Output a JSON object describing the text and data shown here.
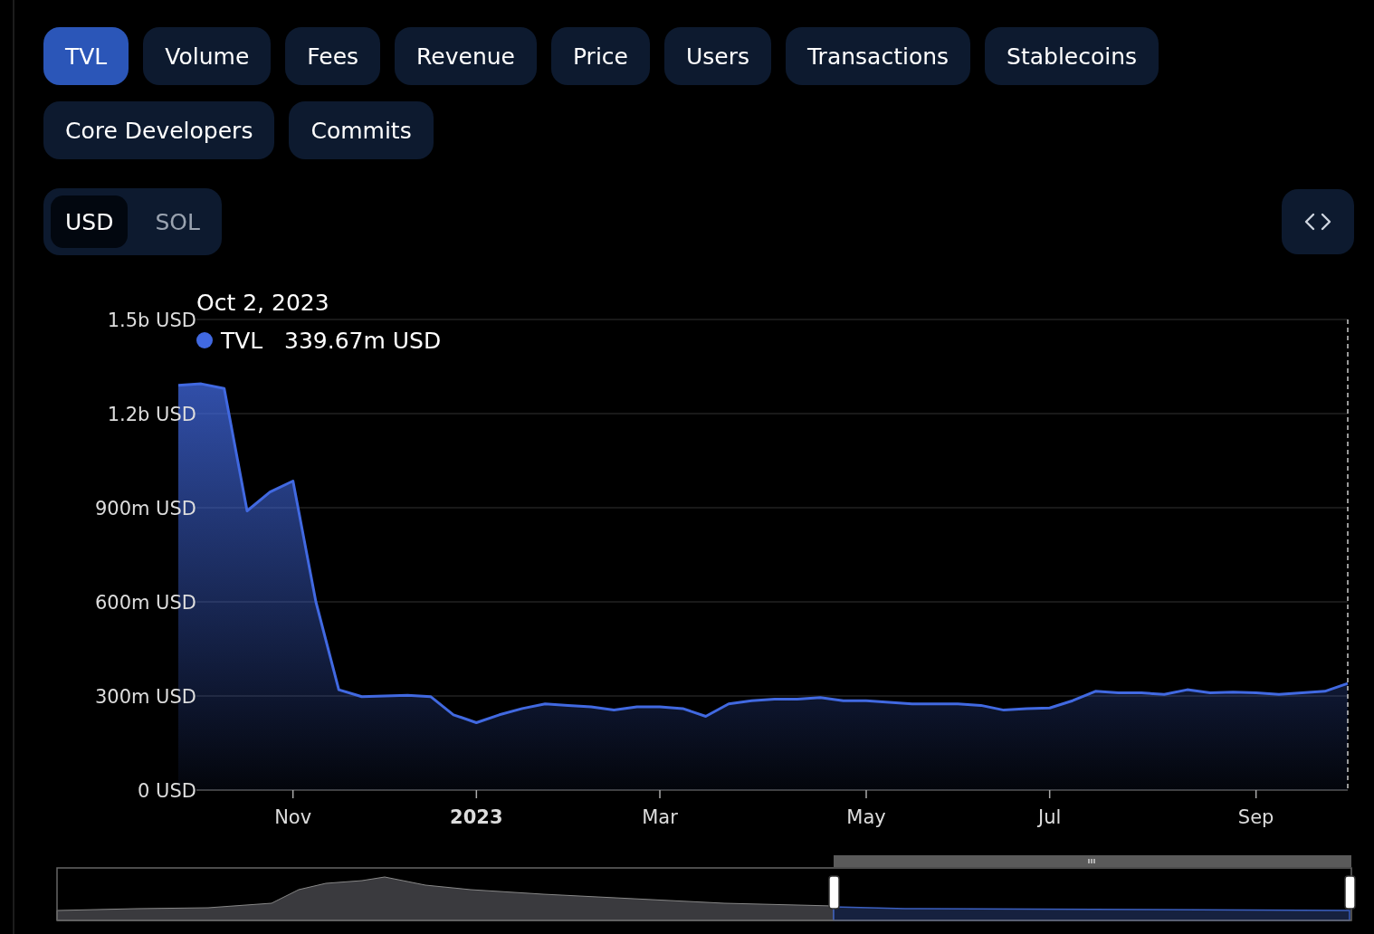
{
  "metric_tabs": [
    {
      "label": "TVL",
      "selected": true
    },
    {
      "label": "Volume",
      "selected": false
    },
    {
      "label": "Fees",
      "selected": false
    },
    {
      "label": "Revenue",
      "selected": false
    },
    {
      "label": "Price",
      "selected": false
    },
    {
      "label": "Users",
      "selected": false
    },
    {
      "label": "Transactions",
      "selected": false
    },
    {
      "label": "Stablecoins",
      "selected": false
    },
    {
      "label": "Core Developers",
      "selected": false
    },
    {
      "label": "Commits",
      "selected": false
    }
  ],
  "currency_toggle": [
    {
      "label": "USD",
      "selected": true
    },
    {
      "label": "SOL",
      "selected": false
    }
  ],
  "chart": {
    "tooltip": {
      "date": "Oct 2, 2023",
      "value": "339.67m USD"
    },
    "chart_data": {
      "type": "area",
      "categories": [
        null,
        null,
        null,
        null,
        null,
        "Nov",
        null,
        null,
        null,
        null,
        null,
        null,
        null,
        "2023",
        null,
        null,
        null,
        null,
        null,
        null,
        null,
        "Mar",
        null,
        null,
        null,
        null,
        null,
        null,
        null,
        null,
        "May",
        null,
        null,
        null,
        null,
        null,
        null,
        null,
        "Jul",
        null,
        null,
        null,
        null,
        null,
        null,
        null,
        null,
        "Sep",
        null,
        null,
        null,
        null
      ],
      "series": [
        {
          "name": "TVL",
          "color": "#4169e1",
          "values": [
            1290000000,
            1295000000,
            1280000000,
            890000000,
            950000000,
            985000000,
            600000000,
            320000000,
            298000000,
            300000000,
            302000000,
            298000000,
            240000000,
            215000000,
            240000000,
            260000000,
            275000000,
            270000000,
            265000000,
            255000000,
            265000000,
            265000000,
            260000000,
            235000000,
            275000000,
            285000000,
            290000000,
            290000000,
            295000000,
            285000000,
            285000000,
            280000000,
            275000000,
            275000000,
            275000000,
            270000000,
            255000000,
            260000000,
            262000000,
            285000000,
            315000000,
            310000000,
            310000000,
            305000000,
            320000000,
            310000000,
            312000000,
            310000000,
            305000000,
            310000000,
            315000000,
            340000000
          ]
        }
      ],
      "ylim": [
        0,
        1500000000
      ],
      "grid": true,
      "yticks": [
        {
          "value": 0,
          "label": "0 USD"
        },
        {
          "value": 300000000,
          "label": "300m USD"
        },
        {
          "value": 600000000,
          "label": "600m USD"
        },
        {
          "value": 900000000,
          "label": "900m USD"
        },
        {
          "value": 1200000000,
          "label": "1.2b USD"
        },
        {
          "value": 1500000000,
          "label": "1.5b USD"
        }
      ]
    }
  }
}
